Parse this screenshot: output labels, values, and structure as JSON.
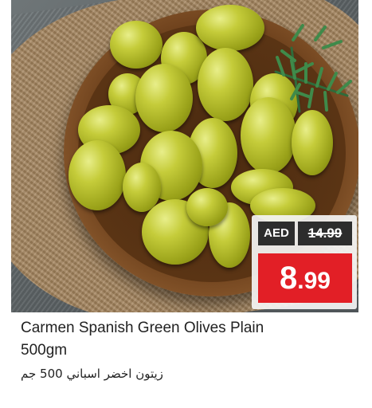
{
  "product": {
    "name": "Carmen Spanish Green Olives Plain",
    "size": "500gm",
    "name_arabic": "زيتون اخضر اسباني 500 جم"
  },
  "price": {
    "currency": "AED",
    "old_price": "14.99",
    "new_price_int": "8",
    "new_price_dec": ".99"
  },
  "colors": {
    "sale_red": "#e21f26",
    "tag_dark": "#2d2d2d"
  },
  "image": {
    "icon": "olives-bowl-photo"
  }
}
